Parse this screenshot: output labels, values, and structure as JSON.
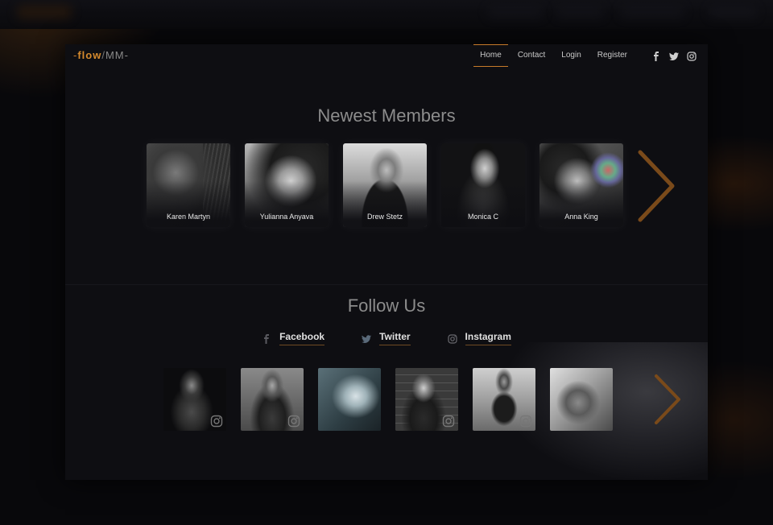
{
  "nav": {
    "logo": {
      "dash_left": "-",
      "flow": "flow",
      "slash": "/",
      "mm": "MM",
      "dash_right": "-"
    },
    "menu": [
      {
        "label": "Home",
        "active": true
      },
      {
        "label": "Contact",
        "active": false
      },
      {
        "label": "Login",
        "active": false
      },
      {
        "label": "Register",
        "active": false
      }
    ],
    "social_icons": [
      "facebook-icon",
      "twitter-icon",
      "instagram-icon"
    ]
  },
  "members_section": {
    "title": "Newest Members",
    "members": [
      {
        "name": "Karen Martyn"
      },
      {
        "name": "Yulianna Anyava"
      },
      {
        "name": "Drew Stetz"
      },
      {
        "name": "Monica C"
      },
      {
        "name": "Anna King"
      }
    ],
    "next_icon": "chevron-right-icon"
  },
  "follow_section": {
    "title": "Follow Us",
    "links": [
      {
        "label": "Facebook",
        "icon": "facebook-icon"
      },
      {
        "label": "Twitter",
        "icon": "twitter-icon"
      },
      {
        "label": "Instagram",
        "icon": "instagram-icon"
      }
    ],
    "instagram_posts": 6,
    "next_icon": "chevron-right-icon"
  },
  "colors": {
    "accent": "#c77a2a",
    "background": "#0e0e12",
    "text": "#cfcfcf"
  }
}
